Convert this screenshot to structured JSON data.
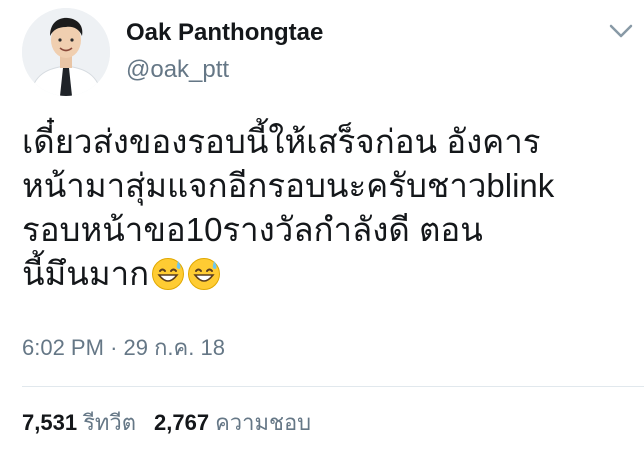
{
  "author": {
    "name": "Oak Panthongtae",
    "handle": "@oak_ptt"
  },
  "tweet": {
    "lines": [
      "เดี๋ยวส่งของรอบนี้ให้เสร็จก่อน อังคาร",
      "หน้ามาสุ่มแจกอีกรอบนะครับชาวblink",
      "รอบหน้าขอ10รางวัลกำลังดี ตอน",
      "นี้มึนมาก"
    ],
    "emoji": [
      "grinning-face-with-sweat",
      "grinning-face-with-sweat"
    ],
    "time": "6:02 PM",
    "separator": "·",
    "date": "29 ก.ค. 18"
  },
  "stats": {
    "retweets_count": "7,531",
    "retweets_label": "รีทวีต",
    "likes_count": "2,767",
    "likes_label": "ความชอบ"
  },
  "colors": {
    "text": "#14171a",
    "secondary": "#657786",
    "divider": "#e1e8ed"
  }
}
